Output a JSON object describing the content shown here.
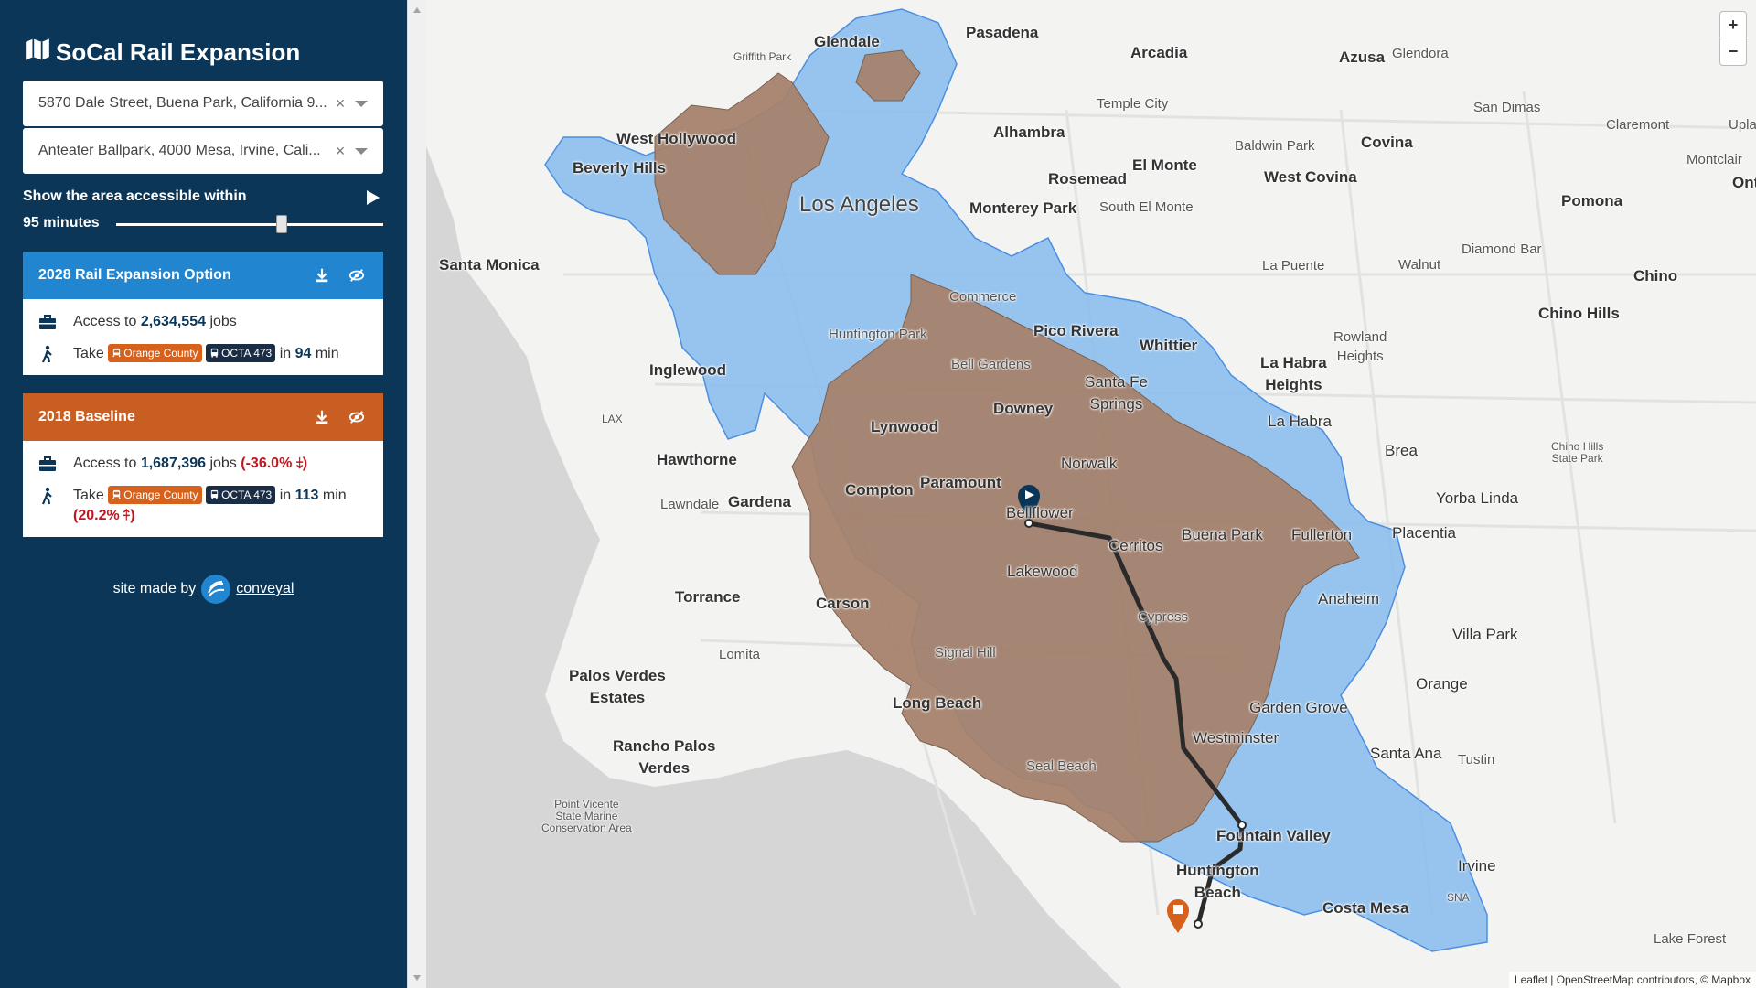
{
  "sidebar": {
    "app_title": "SoCal Rail Expansion",
    "from_value": "5870 Dale Street, Buena Park, California 9...",
    "to_value": "Anteater Ballpark, 4000 Mesa, Irvine, Cali...",
    "clear_symbol": "×",
    "access_label": "Show the area accessible within",
    "minutes_label": "95 minutes",
    "slider_value_fraction": 0.62,
    "cards": [
      {
        "title": "2028 Rail Expansion Option",
        "access_prefix": "Access to",
        "jobs": "2,634,554",
        "jobs_suffix": "jobs",
        "take_prefix": "Take",
        "route_1": "Orange County",
        "route_2": "OCTA 473",
        "in_prefix": "in",
        "minutes": "94",
        "min_suffix": "min"
      },
      {
        "title": "2018 Baseline",
        "access_prefix": "Access to",
        "jobs": "1,687,396",
        "jobs_suffix": "jobs",
        "jobs_change": "(-36.0% ⤈)",
        "take_prefix": "Take",
        "route_1": "Orange County",
        "route_2": "OCTA 473",
        "in_prefix": "in",
        "minutes": "113",
        "min_suffix": "min",
        "time_change": "(20.2% ⤉)"
      }
    ],
    "credit_text": "site made by",
    "credit_link": "conveyal"
  },
  "map": {
    "zoom_in": "+",
    "zoom_out": "−",
    "attribution": "Leaflet | OpenStreetMap contributors, © Mapbox",
    "colors": {
      "baseline_area": "#a5826b",
      "expansion_area": "#8cbfed",
      "route": "#2a2a2a",
      "origin_marker": "#0b3657",
      "dest_marker": "#d6611c"
    },
    "places": {
      "glendale": "Glendale",
      "pasadena": "Pasadena",
      "arcadia": "Arcadia",
      "azusa": "Azusa",
      "glendora": "Glendora",
      "griffith_park": "Griffith Park",
      "temple_city": "Temple City",
      "san_dimas": "San Dimas",
      "claremont": "Claremont",
      "upland": "Upla",
      "west_hollywood": "West Hollywood",
      "alhambra": "Alhambra",
      "baldwin_park": "Baldwin Park",
      "covina": "Covina",
      "montclair": "Montclair",
      "ontario": "Onta",
      "beverly_hills": "Beverly Hills",
      "los_angeles": "Los Angeles",
      "rosemead": "Rosemead",
      "el_monte": "El Monte",
      "west_covina": "West Covina",
      "monterey_park": "Monterey Park",
      "south_el_monte": "South El Monte",
      "pomona": "Pomona",
      "diamond_bar": "Diamond Bar",
      "santa_monica": "Santa Monica",
      "commerce": "Commerce",
      "la_puente": "La Puente",
      "walnut": "Walnut",
      "chino": "Chino",
      "huntington_park": "Huntington Park",
      "pico_rivera": "Pico Rivera",
      "rowland_heights": "Rowland\nHeights",
      "chino_hills": "Chino Hills",
      "whittier": "Whittier",
      "bell_gardens": "Bell Gardens",
      "inglewood": "Inglewood",
      "santa_fe_springs": "Santa Fe\nSprings",
      "la_habra_heights": "La Habra\nHeights",
      "lax": "LAX",
      "downey": "Downey",
      "la_habra": "La Habra",
      "lynwood": "Lynwood",
      "chino_hills_sp": "Chino Hills\nState Park",
      "brea": "Brea",
      "hawthorne": "Hawthorne",
      "norwalk": "Norwalk",
      "compton": "Compton",
      "paramount": "Paramount",
      "lawndale": "Lawndale",
      "gardena": "Gardena",
      "yorba_linda": "Yorba Linda",
      "bellflower": "Bellflower",
      "buena_park": "Buena Park",
      "fullerton": "Fullerton",
      "placentia": "Placentia",
      "cerritos": "Cerritos",
      "lakewood": "Lakewood",
      "torrance": "Torrance",
      "carson": "Carson",
      "anaheim": "Anaheim",
      "cypress": "Cypress",
      "lomita": "Lomita",
      "villa_park": "Villa Park",
      "signal_hill": "Signal Hill",
      "palos_verdes": "Palos Verdes\nEstates",
      "orange": "Orange",
      "long_beach": "Long Beach",
      "garden_grove": "Garden Grove",
      "westminster": "Westminster",
      "rancho_palos_verdes": "Rancho Palos\nVerdes",
      "seal_beach": "Seal Beach",
      "santa_ana": "Santa Ana",
      "tustin": "Tustin",
      "point_vicente": "Point Vicente\nState Marine\nConservation Area",
      "fountain_valley": "Fountain Valley",
      "irvine": "Irvine",
      "huntington_beach": "Huntington\nBeach",
      "sna": "SNA",
      "costa_mesa": "Costa Mesa",
      "lake_forest": "Lake Forest"
    }
  }
}
